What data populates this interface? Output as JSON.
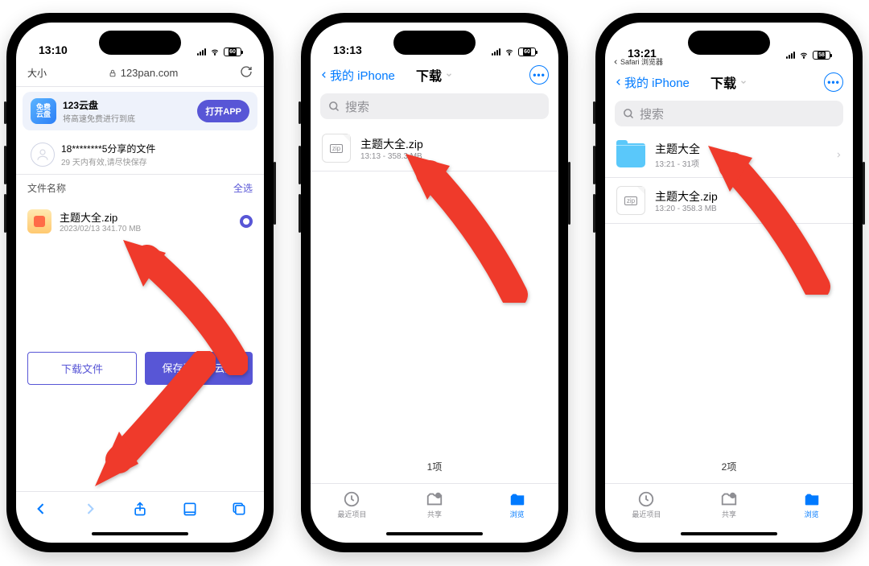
{
  "phone1": {
    "time": "13:10",
    "battery": "60",
    "url_small": "大小",
    "url_domain": "123pan.com",
    "banner": {
      "brand_top": "免费",
      "brand_bot": "云盘",
      "name": "123云盘",
      "slogan": "将高速免费进行到底",
      "open": "打开APP"
    },
    "share": {
      "title": "18********5分享的文件",
      "sub": "29 天内有效,请尽快保存"
    },
    "hdr_name": "文件名称",
    "hdr_sel": "全选",
    "file": {
      "name": "主题大全.zip",
      "meta": "2023/02/13 341.70 MB"
    },
    "btn_dl": "下载文件",
    "btn_save": "保存至我的云盘"
  },
  "phone2": {
    "time": "13:13",
    "battery": "60",
    "back": "我的 iPhone",
    "title": "下载",
    "search": "搜索",
    "file": {
      "name": "主题大全.zip",
      "meta": "13:13 - 358.3 MB"
    },
    "count": "1项",
    "tabs": {
      "recent": "最近项目",
      "shared": "共享",
      "browse": "浏览"
    }
  },
  "phone3": {
    "time": "13:21",
    "battery": "58",
    "crumb": "Safari 浏览器",
    "back": "我的 iPhone",
    "title": "下载",
    "search": "搜索",
    "folder": {
      "name": "主题大全",
      "meta": "13:21 - 31项"
    },
    "file": {
      "name": "主题大全.zip",
      "meta": "13:20 - 358.3 MB"
    },
    "count": "2项",
    "tabs": {
      "recent": "最近项目",
      "shared": "共享",
      "browse": "浏览"
    }
  }
}
